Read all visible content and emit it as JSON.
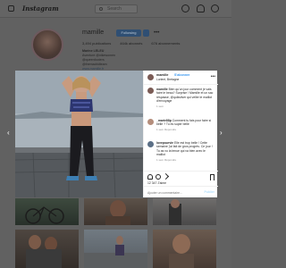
{
  "nav": {
    "brand": "Instagram",
    "search_placeholder": "Search"
  },
  "profile": {
    "username": "mamille",
    "follow_label": "Following",
    "stats": {
      "posts": "3,494 publications",
      "followers": "464k abonnés",
      "following": "676 abonnements"
    },
    "bio": {
      "name": "Marine LELEU",
      "line1": "Aventure @nikewomen",
      "line2": "@queenfooters",
      "line3": "@themadridteam",
      "link": "www.mamille.fr"
    }
  },
  "post": {
    "username": "mamille",
    "follow_link": "S'abonner",
    "location": "Lorient, Bretagne",
    "comments": [
      {
        "user": "mamille",
        "text": "Bien qu'un jour comment je vais faire le beau? Surprise ! Mamille et un sac réspasse, @quiksilver qui veller le maillot d'envoyage",
        "meta": "1 sem"
      },
      {
        "user": "_marie88p",
        "text": "Comment tu fais pour faire si belle ? Tu es super belle",
        "meta": "1 sem  Répondre"
      },
      {
        "user": "lovepourvie",
        "text": "Elle est trop belle ! Cette semaine j'ai fait de gros progrès. Ce jour ! Tu as vu la tenue qui va bien avec le maillot",
        "meta": "1 sem  Répondre"
      }
    ],
    "likes": "12 347 J'aime",
    "comment_placeholder": "Ajouter un commentaire...",
    "post_label": "Publier"
  },
  "icons": {
    "prev": "‹",
    "next": "›",
    "close": "×",
    "more": "•••"
  }
}
